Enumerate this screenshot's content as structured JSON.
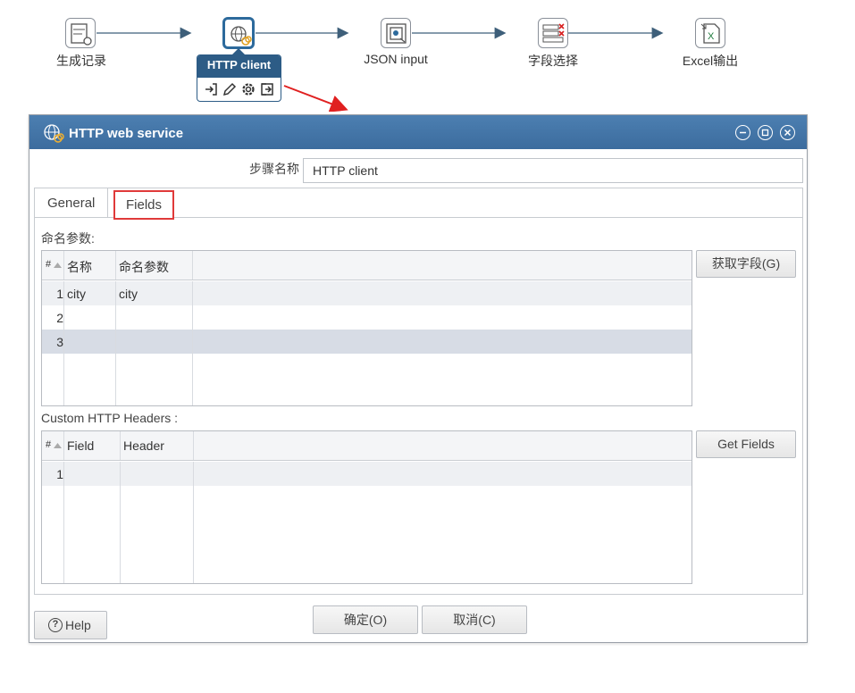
{
  "flow": {
    "steps": [
      {
        "label": "生成记录",
        "icon": "generate-rows-icon"
      },
      {
        "label": "",
        "icon": "http-client-icon"
      },
      {
        "label": "JSON input",
        "icon": "json-input-icon"
      },
      {
        "label": "字段选择",
        "icon": "select-values-icon"
      },
      {
        "label": "Excel输出",
        "icon": "excel-output-icon"
      }
    ],
    "hover_card": {
      "title": "HTTP client",
      "actions": [
        "input-icon",
        "edit-icon",
        "settings-icon",
        "output-icon"
      ]
    }
  },
  "dialog": {
    "title": "HTTP web service",
    "step_name_label": "步骤名称",
    "step_name_value": "HTTP client",
    "tabs": [
      {
        "label": "General"
      },
      {
        "label": "Fields"
      }
    ],
    "named_params": {
      "label": "命名参数:",
      "columns": [
        "#",
        "名称",
        "命名参数"
      ],
      "rows": [
        {
          "num": "1",
          "name": "city",
          "param": "city"
        },
        {
          "num": "2",
          "name": "",
          "param": ""
        },
        {
          "num": "3",
          "name": "",
          "param": ""
        }
      ],
      "button": "获取字段(G)"
    },
    "headers": {
      "label": "Custom HTTP Headers :",
      "columns": [
        "#",
        "Field",
        "Header"
      ],
      "rows": [
        {
          "num": "1",
          "field": "",
          "header": ""
        }
      ],
      "button": "Get Fields"
    },
    "buttons": {
      "help": "Help",
      "ok": "确定(O)",
      "cancel": "取消(C)"
    }
  },
  "colors": {
    "titlebar": "#3c6c9e",
    "selected_row": "#d7dce5",
    "tab_highlight": "#e03a3a",
    "arrow": "#e02020"
  }
}
